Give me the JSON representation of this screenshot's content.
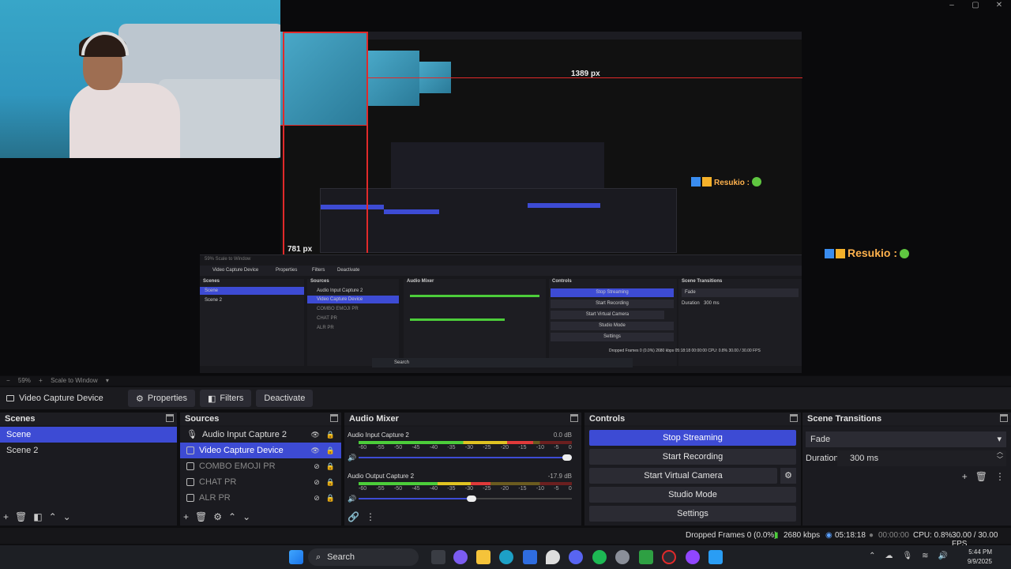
{
  "window": {
    "controls": [
      "–",
      "▢",
      "✕"
    ]
  },
  "preview": {
    "px_label_top": "1389 px",
    "px_label_left": "781 px",
    "overlay_name": "Resukio :",
    "inner_overlay_name": "Resukio :"
  },
  "mini_obs": {
    "source": "Video Capture Device",
    "buttons": [
      "Properties",
      "Filters",
      "Deactivate"
    ],
    "docks": [
      "Scenes",
      "Sources",
      "Audio Mixer",
      "Controls",
      "Scene Transitions"
    ],
    "scenes": [
      "Scene",
      "Scene 2"
    ],
    "sources": [
      "Audio Input Capture 2",
      "Video Capture Device",
      "COMBO EMOJI PR",
      "CHAT PR",
      "ALR PR"
    ],
    "controls": [
      "Stop Streaming",
      "Start Recording",
      "Start Virtual Camera",
      "Studio Mode",
      "Settings"
    ],
    "transition": "Fade",
    "duration_label": "Duration",
    "duration": "300 ms",
    "status": "Dropped Frames 0 (0.0%)   2680 kbps   05:18:18   00:00:00   CPU: 0.8%   30.00 / 30.00 FPS",
    "search": "Search",
    "zoom": "59%   Scale to Window"
  },
  "zoombar": {
    "zoom": "59%",
    "scale": "Scale to Window"
  },
  "source_toolbar": {
    "source_name": "Video Capture Device",
    "properties": "Properties",
    "filters": "Filters",
    "deactivate": "Deactivate"
  },
  "scenes": {
    "title": "Scenes",
    "items": [
      "Scene",
      "Scene 2"
    ]
  },
  "sources": {
    "title": "Sources",
    "items": [
      "Audio Input Capture 2",
      "Video Capture Device",
      "COMBO EMOJI PR",
      "CHAT PR",
      "ALR PR"
    ]
  },
  "mixer": {
    "title": "Audio Mixer",
    "channels": [
      {
        "name": "Audio Input Capture 2",
        "db": "0.0 dB",
        "level": 0.82,
        "volume": 1.0
      },
      {
        "name": "Audio Output Capture 2",
        "db": "-17.9 dB",
        "level": 0.62,
        "volume": 0.55
      }
    ],
    "ticks": [
      "-60",
      "-55",
      "-50",
      "-45",
      "-40",
      "-35",
      "-30",
      "-25",
      "-20",
      "-15",
      "-10",
      "-5",
      "0"
    ]
  },
  "controls": {
    "title": "Controls",
    "stop_streaming": "Stop Streaming",
    "start_recording": "Start Recording",
    "start_virtual_camera": "Start Virtual Camera",
    "studio_mode": "Studio Mode",
    "settings": "Settings"
  },
  "transitions": {
    "title": "Scene Transitions",
    "selected": "Fade",
    "duration_label": "Duration",
    "duration_value": "300 ms"
  },
  "status": {
    "dropped": "Dropped Frames 0 (0.0%)",
    "bitrate": "2680 kbps",
    "stream_time": "05:18:18",
    "rec_time": "00:00:00",
    "cpu": "CPU: 0.8%",
    "fps": "30.00 / 30.00 FPS"
  },
  "taskbar": {
    "search": "Search",
    "time": "5:44 PM",
    "date": "9/9/2025"
  },
  "colors": {
    "accent": "#3d4bd4",
    "meter_green": "#4ccd3a",
    "meter_yellow": "#e0c322",
    "meter_red": "#e03a3a",
    "overlay_text": "#ffb24d"
  }
}
